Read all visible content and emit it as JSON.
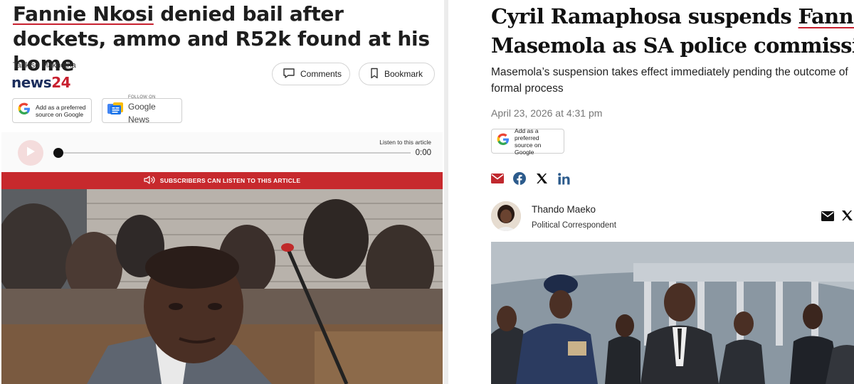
{
  "left_article": {
    "headline_name": "Fannie Nkosi",
    "headline_rest": " denied bail after dockets, ammo and R52k found at his home",
    "author": "Tankiso Makhetha",
    "logo_news": "news",
    "logo_24": "24",
    "comments_label": "Comments",
    "bookmark_label": "Bookmark",
    "preferred_source_line1": "Add as a preferred",
    "preferred_source_line2": "source on Google",
    "follow_on": "FOLLOW ON",
    "google_news": "Google News",
    "listen_label": "Listen to this article",
    "player_time": "0:00",
    "subscribers_banner": "SUBSCRIBERS CAN LISTEN TO THIS ARTICLE",
    "player_progress": 0
  },
  "right_article": {
    "headline_line1_pre": "Cyril Ramaphosa suspends ",
    "headline_line1_name": "Fannie",
    "headline_line2": "Masemola as SA police commissioner",
    "subhead_line1": "Masemola’s suspension takes effect immediately pending the outcome of",
    "subhead_line2": "formal process",
    "date": "April 23, 2026 at 4:31 pm",
    "preferred_source_line1": "Add as a preferred",
    "preferred_source_line2": "source on Google",
    "author_name": "Thando Maeko",
    "author_role": "Political Correspondent"
  },
  "icons": {
    "share": [
      "mail-icon",
      "facebook-icon",
      "x-icon",
      "linkedin-icon"
    ],
    "author_share": [
      "mail-icon",
      "x-icon"
    ]
  },
  "colors": {
    "brand_red": "#c7292d",
    "news24_navy": "#1b2d5c",
    "share_red": "#c0282e",
    "share_blue": "#2c5b8c"
  }
}
